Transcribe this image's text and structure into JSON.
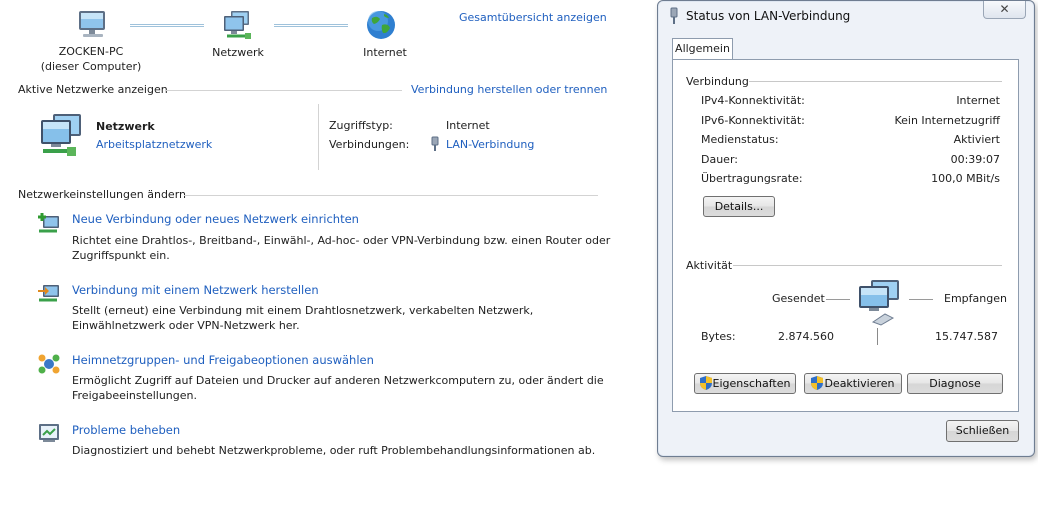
{
  "network_map": {
    "computer_name": "ZOCKEN-PC",
    "computer_sub": "(dieser Computer)",
    "network_label": "Netzwerk",
    "internet_label": "Internet",
    "overview_link": "Gesamtübersicht anzeigen"
  },
  "active_networks": {
    "heading": "Aktive Netzwerke anzeigen",
    "connect_link": "Verbindung herstellen oder trennen",
    "network_name": "Netzwerk",
    "network_type": "Arbeitsplatznetzwerk",
    "access_type_label": "Zugriffstyp:",
    "access_type_value": "Internet",
    "connections_label": "Verbindungen:",
    "connections_value": "LAN-Verbindung"
  },
  "settings": {
    "heading": "Netzwerkeinstellungen ändern",
    "tasks": [
      {
        "title": "Neue Verbindung oder neues Netzwerk einrichten",
        "desc": "Richtet eine Drahtlos-, Breitband-, Einwähl-, Ad-hoc- oder VPN-Verbindung bzw. einen Router oder Zugriffspunkt ein."
      },
      {
        "title": "Verbindung mit einem Netzwerk herstellen",
        "desc": "Stellt (erneut) eine Verbindung mit einem Drahtlosnetzwerk, verkabelten Netzwerk, Einwählnetzwerk oder VPN-Netzwerk her."
      },
      {
        "title": "Heimnetzgruppen- und Freigabeoptionen auswählen",
        "desc": "Ermöglicht Zugriff auf Dateien und Drucker auf anderen Netzwerkcomputern zu, oder ändert die Freigabeeinstellungen."
      },
      {
        "title": "Probleme beheben",
        "desc": "Diagnostiziert und behebt Netzwerkprobleme, oder ruft Problembehandlungsinformationen ab."
      }
    ]
  },
  "dialog": {
    "title": "Status von LAN-Verbindung",
    "close_glyph": "✕",
    "tab_label": "Allgemein",
    "connection_group": "Verbindung",
    "rows": [
      {
        "label": "IPv4-Konnektivität:",
        "value": "Internet"
      },
      {
        "label": "IPv6-Konnektivität:",
        "value": "Kein Internetzugriff"
      },
      {
        "label": "Medienstatus:",
        "value": "Aktiviert"
      },
      {
        "label": "Dauer:",
        "value": "00:39:07"
      },
      {
        "label": "Übertragungsrate:",
        "value": "100,0 MBit/s"
      }
    ],
    "details_button": "Details...",
    "activity_group": "Aktivität",
    "sent_label": "Gesendet",
    "received_label": "Empfangen",
    "bytes_label": "Bytes:",
    "bytes_sent": "2.874.560",
    "bytes_received": "15.747.587",
    "properties_button": "Eigenschaften",
    "disable_button": "Deaktivieren",
    "diagnose_button": "Diagnose",
    "close_button": "Schließen"
  }
}
